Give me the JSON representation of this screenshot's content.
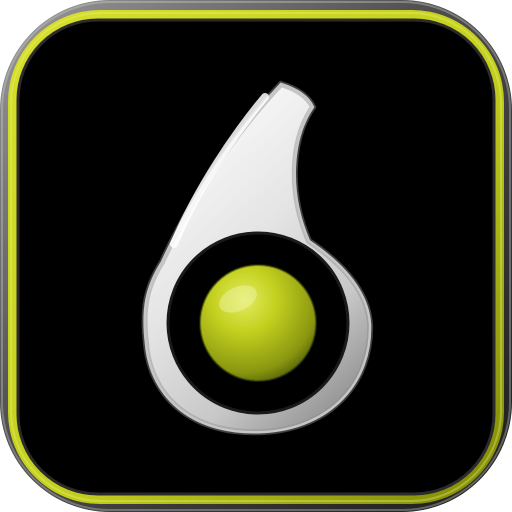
{
  "icon": {
    "name": "whistle-icon",
    "colors": {
      "background": "#000000",
      "outer_bezel": "#8c8c8c",
      "accent_ring": "#c6d21f",
      "accent_ring_dark": "#6f7a09",
      "whistle_body_light": "#ffffff",
      "whistle_body_mid": "#d9d9d9",
      "whistle_body_dark": "#9b9b9b",
      "center_ball": "#b8c51a",
      "center_ball_dark": "#5f6c07",
      "center_ball_highlight": "#e6ef7a"
    }
  }
}
